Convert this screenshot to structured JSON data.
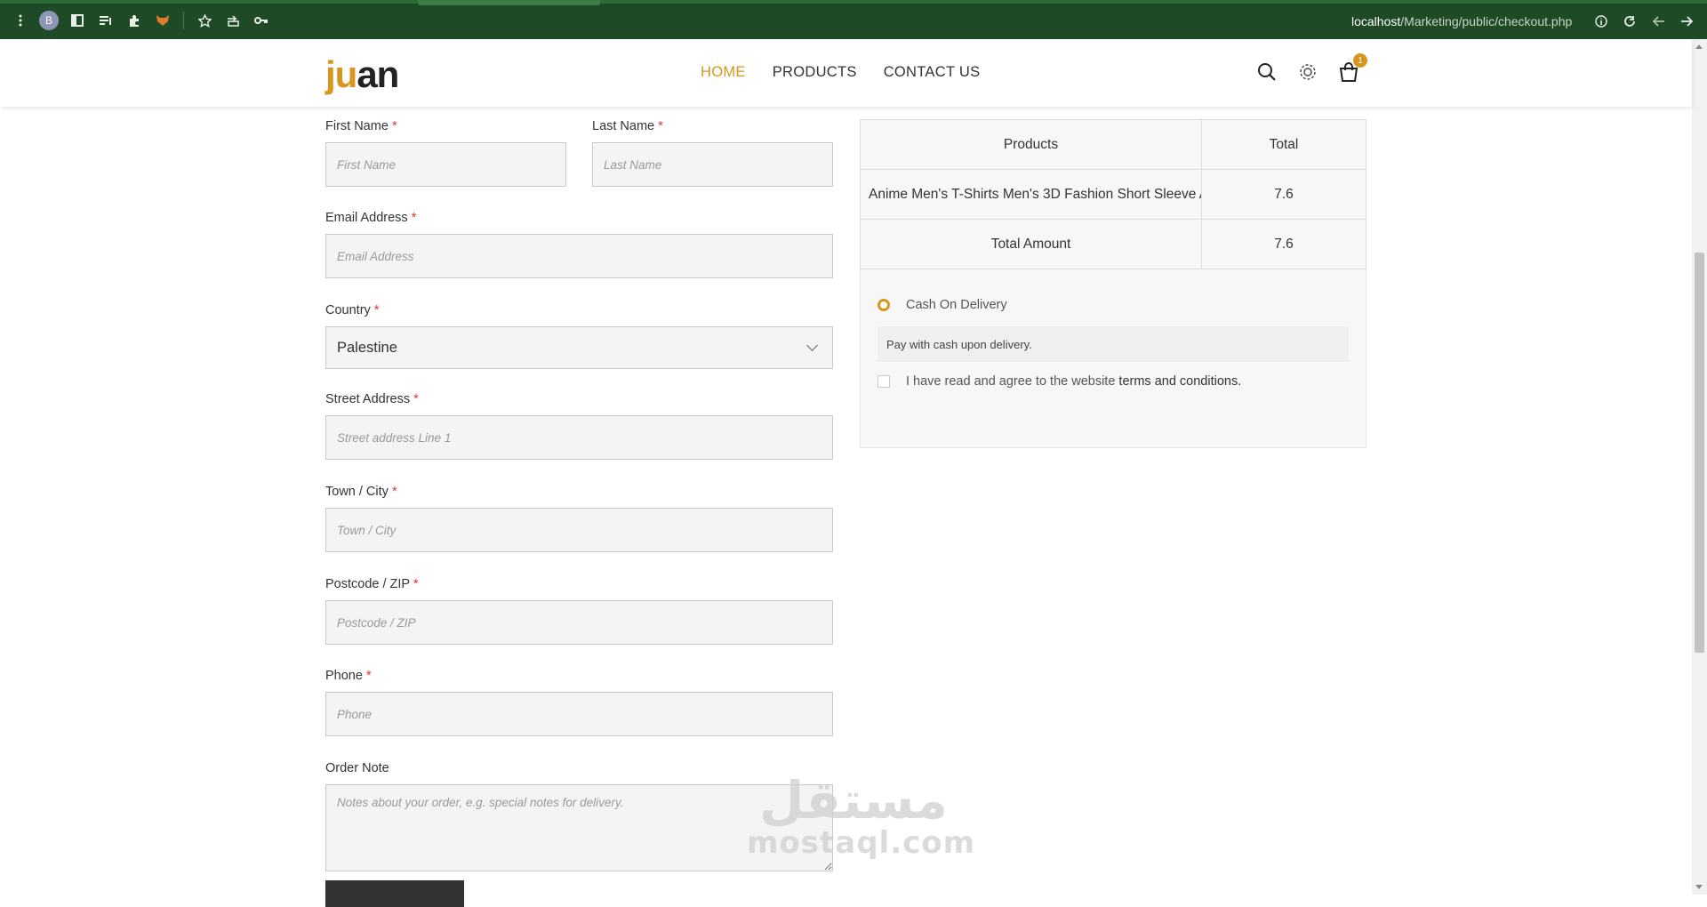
{
  "browser": {
    "profile_initial": "B",
    "url_host": "localhost",
    "url_path": "/Marketing/public/checkout.php",
    "icons": [
      "menu-icon",
      "sidebar-icon",
      "reading-list-icon",
      "extensions-icon",
      "fox-extension-icon",
      "bookmark-star-icon",
      "share-icon",
      "key-icon",
      "info-icon",
      "reload-icon",
      "back-icon",
      "forward-icon"
    ]
  },
  "site": {
    "logo_part1": "ju",
    "logo_part2": "an",
    "brand_color": "#d8961f",
    "nav": {
      "home": "HOME",
      "products": "PRODUCTS",
      "contact": "CONTACT US"
    },
    "cart_count": "1"
  },
  "form": {
    "first_name": {
      "label": "First Name",
      "required": "*",
      "placeholder": "First Name"
    },
    "last_name": {
      "label": "Last Name",
      "required": "*",
      "placeholder": "Last Name"
    },
    "email": {
      "label": "Email Address",
      "required": "*",
      "placeholder": "Email Address"
    },
    "country": {
      "label": "Country",
      "required": "*",
      "value": "Palestine"
    },
    "street": {
      "label": "Street Address",
      "required": "*",
      "placeholder": "Street address Line 1"
    },
    "city": {
      "label": "Town / City",
      "required": "*",
      "placeholder": "Town / City"
    },
    "zip": {
      "label": "Postcode / ZIP",
      "required": "*",
      "placeholder": "Postcode / ZIP"
    },
    "phone": {
      "label": "Phone",
      "required": "*",
      "placeholder": "Phone"
    },
    "note": {
      "label": "Order Note",
      "placeholder": "Notes about your order, e.g. special notes for delivery."
    }
  },
  "order": {
    "headers": {
      "products": "Products",
      "total": "Total"
    },
    "items": [
      {
        "name": "Anime Men's T-Shirts Men's 3D Fashion Short Sleeve A",
        "total": "7.6"
      }
    ],
    "total_label": "Total Amount",
    "total_value": "7.6"
  },
  "payment": {
    "method": "Cash On Delivery",
    "description": "Pay with cash upon delivery.",
    "agree_prefix": "I have read and agree to the website",
    "agree_link": "terms and conditions."
  },
  "watermark": {
    "arabic": "مستقل",
    "latin": "mostaql.com"
  }
}
